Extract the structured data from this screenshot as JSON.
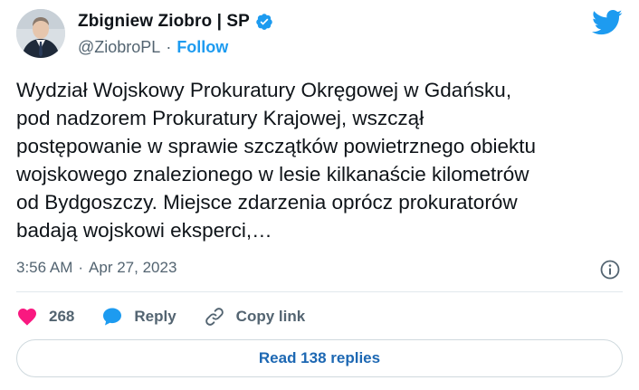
{
  "tweet": {
    "author_name": "Zbigniew Ziobro | SP",
    "handle": "@ZiobroPL",
    "separator": "·",
    "follow_label": "Follow",
    "text": "Wydział Wojskowy Prokuratury Okręgowej w Gdańsku,\npod nadzorem Prokuratury Krajowej, wszczął\npostępowanie w sprawie szczątków powietrznego obiektu\nwojskowego znalezionego w lesie kilkanaście kilometrów\nod Bydgoszczy. Miejsce zdarzenia oprócz prokuratorów\nbadają wojskowi eksperci,…",
    "time": "3:56 AM",
    "date": "Apr 27, 2023",
    "likes": "268",
    "reply_label": "Reply",
    "copy_link_label": "Copy link",
    "read_replies_label": "Read 138 replies"
  },
  "colors": {
    "accent": "#1d9bf0",
    "like": "#f91880",
    "text": "#0f1419",
    "muted": "#536471"
  },
  "icons": {
    "verified": "verified-badge-icon",
    "logo": "twitter-bird-icon",
    "info": "info-icon",
    "like": "heart-icon",
    "reply": "speech-bubble-icon",
    "copy": "link-icon"
  }
}
